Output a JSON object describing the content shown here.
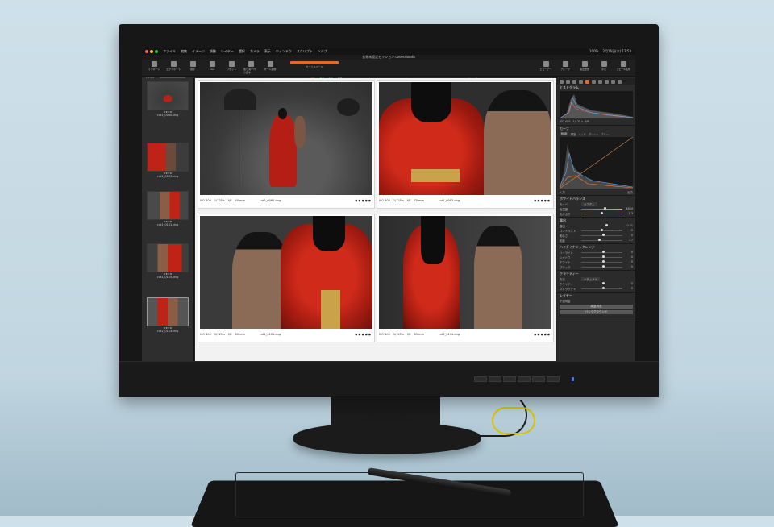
{
  "menubar": {
    "items": [
      "ファイル",
      "編集",
      "イメージ",
      "調整",
      "レイヤー",
      "選択",
      "カメラ",
      "表示",
      "ウィンドウ",
      "スクリプト",
      "ヘルプ"
    ],
    "zoom": "100%",
    "clock": "2月16日(木) 13:53"
  },
  "window": {
    "title": "名称未設定セッション.cosessiondb"
  },
  "toolbar": {
    "left_tools": [
      "インポート",
      "エクスポート",
      "撮影",
      "Live",
      "リセット",
      "取り消す/やり直す",
      "オート調整"
    ],
    "center_label": "カーソルツール",
    "right_tools": [
      "ビューアー",
      "プルーフ",
      "露出警告",
      "手元",
      "コピー&適用"
    ],
    "accent_color": "#e46a2c"
  },
  "subbar": {
    "count": "4/123",
    "album": "バックグラウンド",
    "counts": [
      "31",
      "26",
      "10",
      "27"
    ],
    "size_label": "サイズ"
  },
  "filmstrip": {
    "thumbs": [
      {
        "file": "",
        "rating": ""
      },
      {
        "file": "cut1_0060.dng",
        "rating": "★★★★"
      },
      {
        "file": "cut1_0093.dng",
        "rating": "★★★★"
      },
      {
        "file": "cut1_0101.dng",
        "rating": "★★★★"
      },
      {
        "file": "cut1_0105.dng",
        "rating": "★★★★"
      },
      {
        "file": "cut1_0114.dng",
        "rating": "★★★★"
      }
    ]
  },
  "viewer": {
    "cells": [
      {
        "iso": "ISO 400",
        "shutter": "1/125 s",
        "aperture": "f/8",
        "focal": "40 mm",
        "file": "cut1_0060.dng",
        "rating": "● ● ● ● ●"
      },
      {
        "iso": "ISO 400",
        "shutter": "1/125 s",
        "aperture": "f/8",
        "focal": "70 mm",
        "file": "cut1_0093.dng",
        "rating": "● ● ● ● ●"
      },
      {
        "iso": "ISO 400",
        "shutter": "1/125 s",
        "aperture": "f/8",
        "focal": "60 mm",
        "file": "cut1_0101.dng",
        "rating": "● ● ● ● ●"
      },
      {
        "iso": "ISO 400",
        "shutter": "1/125 s",
        "aperture": "f/8",
        "focal": "89 mm",
        "file": "cut1_0114.dng",
        "rating": "● ● ● ● ●"
      }
    ]
  },
  "panel": {
    "histogram": {
      "title": "ヒストグラム",
      "iso": "ISO 400",
      "shutter": "1/125 s",
      "aperture": "f/8"
    },
    "curve": {
      "title": "カーブ",
      "tabs": [
        "RGB",
        "輝度",
        "レッド",
        "グリーン",
        "ブルー"
      ],
      "input": "入力",
      "output": "出力"
    },
    "white_balance": {
      "title": "ホワイトバランス",
      "mode_label": "モード",
      "mode": "カスタム",
      "rows": [
        {
          "label": "色温度",
          "value": "4804"
        },
        {
          "label": "色かぶり",
          "value": "-1.3"
        }
      ]
    },
    "exposure": {
      "title": "露出",
      "rows": [
        {
          "label": "露出",
          "value": "0.81"
        },
        {
          "label": "コントラスト",
          "value": "-5"
        },
        {
          "label": "明るさ",
          "value": "0"
        },
        {
          "label": "彩度",
          "value": "-17"
        }
      ]
    },
    "hdr": {
      "title": "ハイダイナミックレンジ",
      "rows": [
        {
          "label": "ハイライト",
          "value": "0"
        },
        {
          "label": "シャドウ",
          "value": "0"
        },
        {
          "label": "ホワイト",
          "value": "0"
        },
        {
          "label": "ブラック",
          "value": "0"
        }
      ]
    },
    "clarity": {
      "title": "クラリティー",
      "method_label": "方法",
      "method": "ナチュラル",
      "rows": [
        {
          "label": "クラリティー",
          "value": "0"
        },
        {
          "label": "ストラクチャ",
          "value": "0"
        }
      ]
    },
    "layers": {
      "title": "レイヤー",
      "opacity_label": "不透明度",
      "button_1": "調整消去",
      "button_2": "バックグラウンド"
    }
  }
}
